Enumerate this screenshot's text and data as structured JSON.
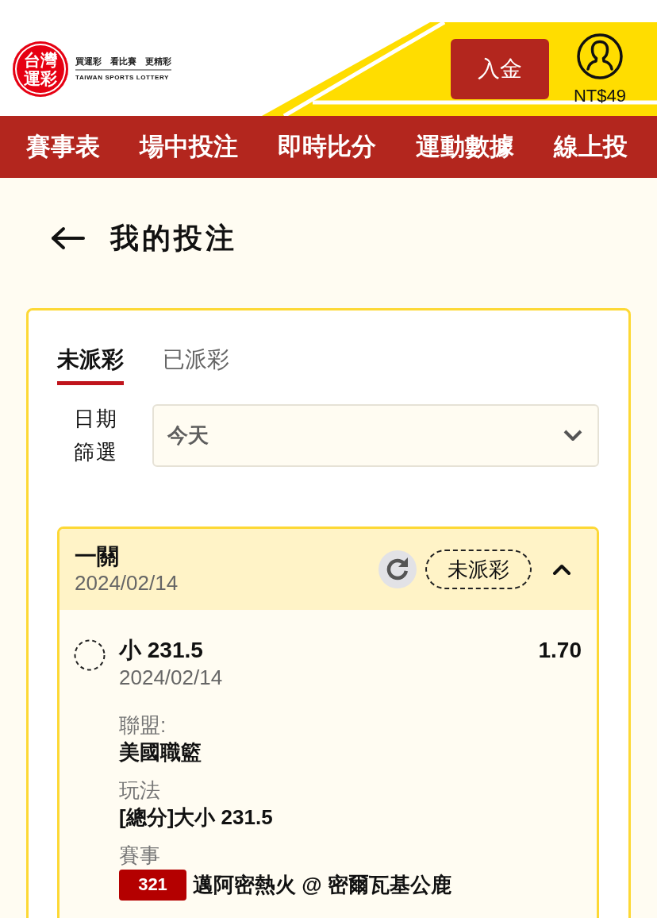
{
  "header": {
    "logo": {
      "emblem": [
        "台灣",
        "運彩"
      ],
      "slogan": "買運彩　看比賽　更精彩",
      "tagline": "TAIWAN SPORTS LOTTERY"
    },
    "deposit_button": "入金",
    "balance": "NT$49"
  },
  "nav": [
    {
      "label": "賽事表"
    },
    {
      "label": "場中投注"
    },
    {
      "label": "即時比分"
    },
    {
      "label": "運動數據"
    },
    {
      "label": "線上投"
    }
  ],
  "page": {
    "title": "我的投注"
  },
  "tabs": [
    {
      "label": "未派彩",
      "selected": true
    },
    {
      "label": "已派彩",
      "selected": false
    }
  ],
  "date_filter": {
    "label": "日期篩選",
    "value": "今天"
  },
  "bets": [
    {
      "type": "一關",
      "date": "2024/02/14",
      "status": "未派彩",
      "expanded": true,
      "selections": [
        {
          "settled": false,
          "pick": "小 231.5",
          "odds": "1.70",
          "date": "2024/02/14",
          "details": [
            {
              "label": "聯盟:",
              "value": "美國職籃"
            },
            {
              "label": "玩法",
              "value": "[總分]大小 231.5"
            },
            {
              "label": "賽事",
              "game_no": "321",
              "value": "邁阿密熱火 @ 密爾瓦基公鹿"
            }
          ]
        }
      ]
    }
  ]
}
